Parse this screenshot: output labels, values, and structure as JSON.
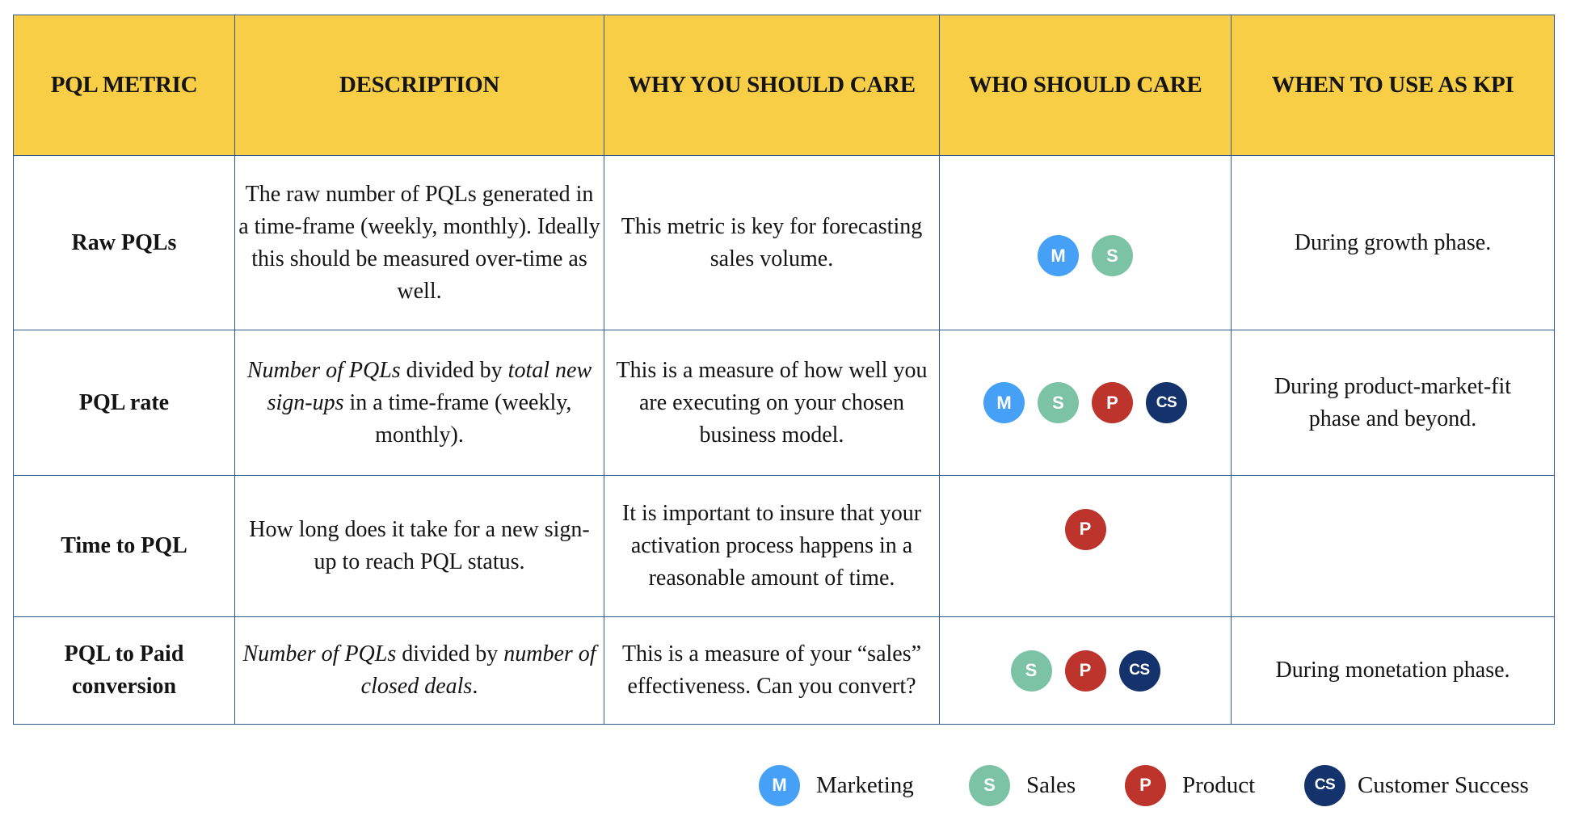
{
  "colors": {
    "header_bg": "#f7ce46",
    "border": "#2f5a8a",
    "marketing": "#46a0f5",
    "sales": "#7cc2a4",
    "product": "#bc342c",
    "customer_success": "#14336c"
  },
  "roles": {
    "M": {
      "abbr": "M",
      "label": "Marketing",
      "color": "#46a0f5"
    },
    "S": {
      "abbr": "S",
      "label": "Sales",
      "color": "#7cc2a4"
    },
    "P": {
      "abbr": "P",
      "label": "Product",
      "color": "#bc342c"
    },
    "CS": {
      "abbr": "CS",
      "label": "Customer Success",
      "color": "#14336c"
    }
  },
  "table": {
    "headers": [
      "PQL METRIC",
      "DESCRIPTION",
      "WHY YOU SHOULD CARE",
      "WHO SHOULD CARE",
      "WHEN TO USE AS KPI"
    ],
    "rows": [
      {
        "metric": "Raw PQLs",
        "description": [
          {
            "text": "The raw number of PQLs generated in a time-frame (weekly, monthly). Ideally this should be measured over-time as well.",
            "italic": false
          }
        ],
        "why": "This metric is key for forecasting sales volume.",
        "who": [
          "M",
          "S"
        ],
        "when": "During growth phase."
      },
      {
        "metric": "PQL rate",
        "description": [
          {
            "text": "Number of PQLs",
            "italic": true
          },
          {
            "text": " divided by ",
            "italic": false
          },
          {
            "text": "total new sign-ups",
            "italic": true
          },
          {
            "text": " in a time-frame (weekly, monthly).",
            "italic": false
          }
        ],
        "why": "This is a measure of how well you are executing on your chosen business model.",
        "who": [
          "M",
          "S",
          "P",
          "CS"
        ],
        "when": "During product-market-fit phase and beyond."
      },
      {
        "metric": "Time to PQL",
        "description": [
          {
            "text": "How long does it take for a new sign-up to reach PQL status.",
            "italic": false
          }
        ],
        "why": "It is important to insure that your activation process happens in a reasonable amount of time.",
        "who": [
          "P"
        ],
        "when": ""
      },
      {
        "metric": "PQL to Paid conversion",
        "description": [
          {
            "text": "Number of PQLs",
            "italic": true
          },
          {
            "text": " divided by ",
            "italic": false
          },
          {
            "text": "number of closed deals",
            "italic": true
          },
          {
            "text": ".",
            "italic": false
          }
        ],
        "why": "This is a measure of your “sales” effectiveness. Can you convert?",
        "who": [
          "S",
          "P",
          "CS"
        ],
        "when": "During monetation phase."
      }
    ]
  },
  "legend": [
    {
      "abbr": "M",
      "label": "Marketing"
    },
    {
      "abbr": "S",
      "label": "Sales"
    },
    {
      "abbr": "P",
      "label": "Product"
    },
    {
      "abbr": "CS",
      "label": "Customer Success"
    }
  ]
}
